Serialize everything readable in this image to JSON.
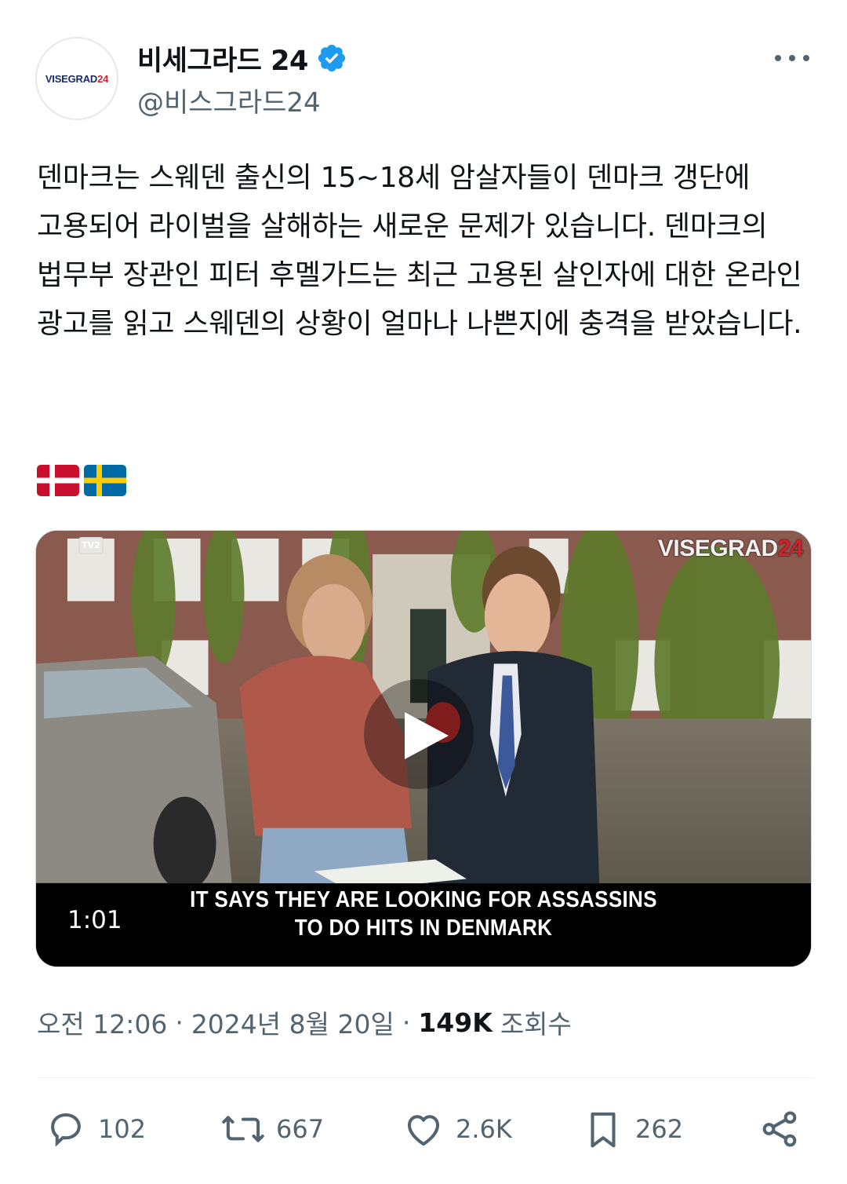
{
  "author": {
    "display_name": "비세그라드 24",
    "handle": "@비스그라드24",
    "avatar_text": "VISEGRAD",
    "avatar_text_num": "24",
    "verified": true,
    "verified_color": "#1d9bf0"
  },
  "tweet": {
    "text": "덴마크는 스웨덴 출신의 15~18세 암살자들이 덴마크 갱단에 고용되어 라이벌을 살해하는 새로운 문제가 있습니다. 덴마크의 법무부 장관인 피터 후멜가드는 최근 고용된 살인자에 대한 온라인 광고를 읽고 스웨덴의 상황이 얼마나 나쁜지에 충격을 받았습니다.",
    "flags": [
      "denmark-flag",
      "sweden-flag"
    ]
  },
  "video": {
    "watermark_text": "VISEGRAD",
    "watermark_num": "24",
    "channel_logo": "TV2",
    "subtitle_line1": "IT SAYS THEY ARE LOOKING FOR ASSASSINS",
    "subtitle_line2": "TO DO HITS IN DENMARK",
    "duration": "1:01"
  },
  "meta": {
    "time": "오전 12:06",
    "date": "2024년 8월 20일",
    "views_count": "149K",
    "views_label": "조회수"
  },
  "actions": {
    "replies": "102",
    "reposts": "667",
    "likes": "2.6K",
    "bookmarks": "262"
  },
  "colors": {
    "text": "#0f1419",
    "secondary": "#536471",
    "brand_red": "#d4202a"
  }
}
